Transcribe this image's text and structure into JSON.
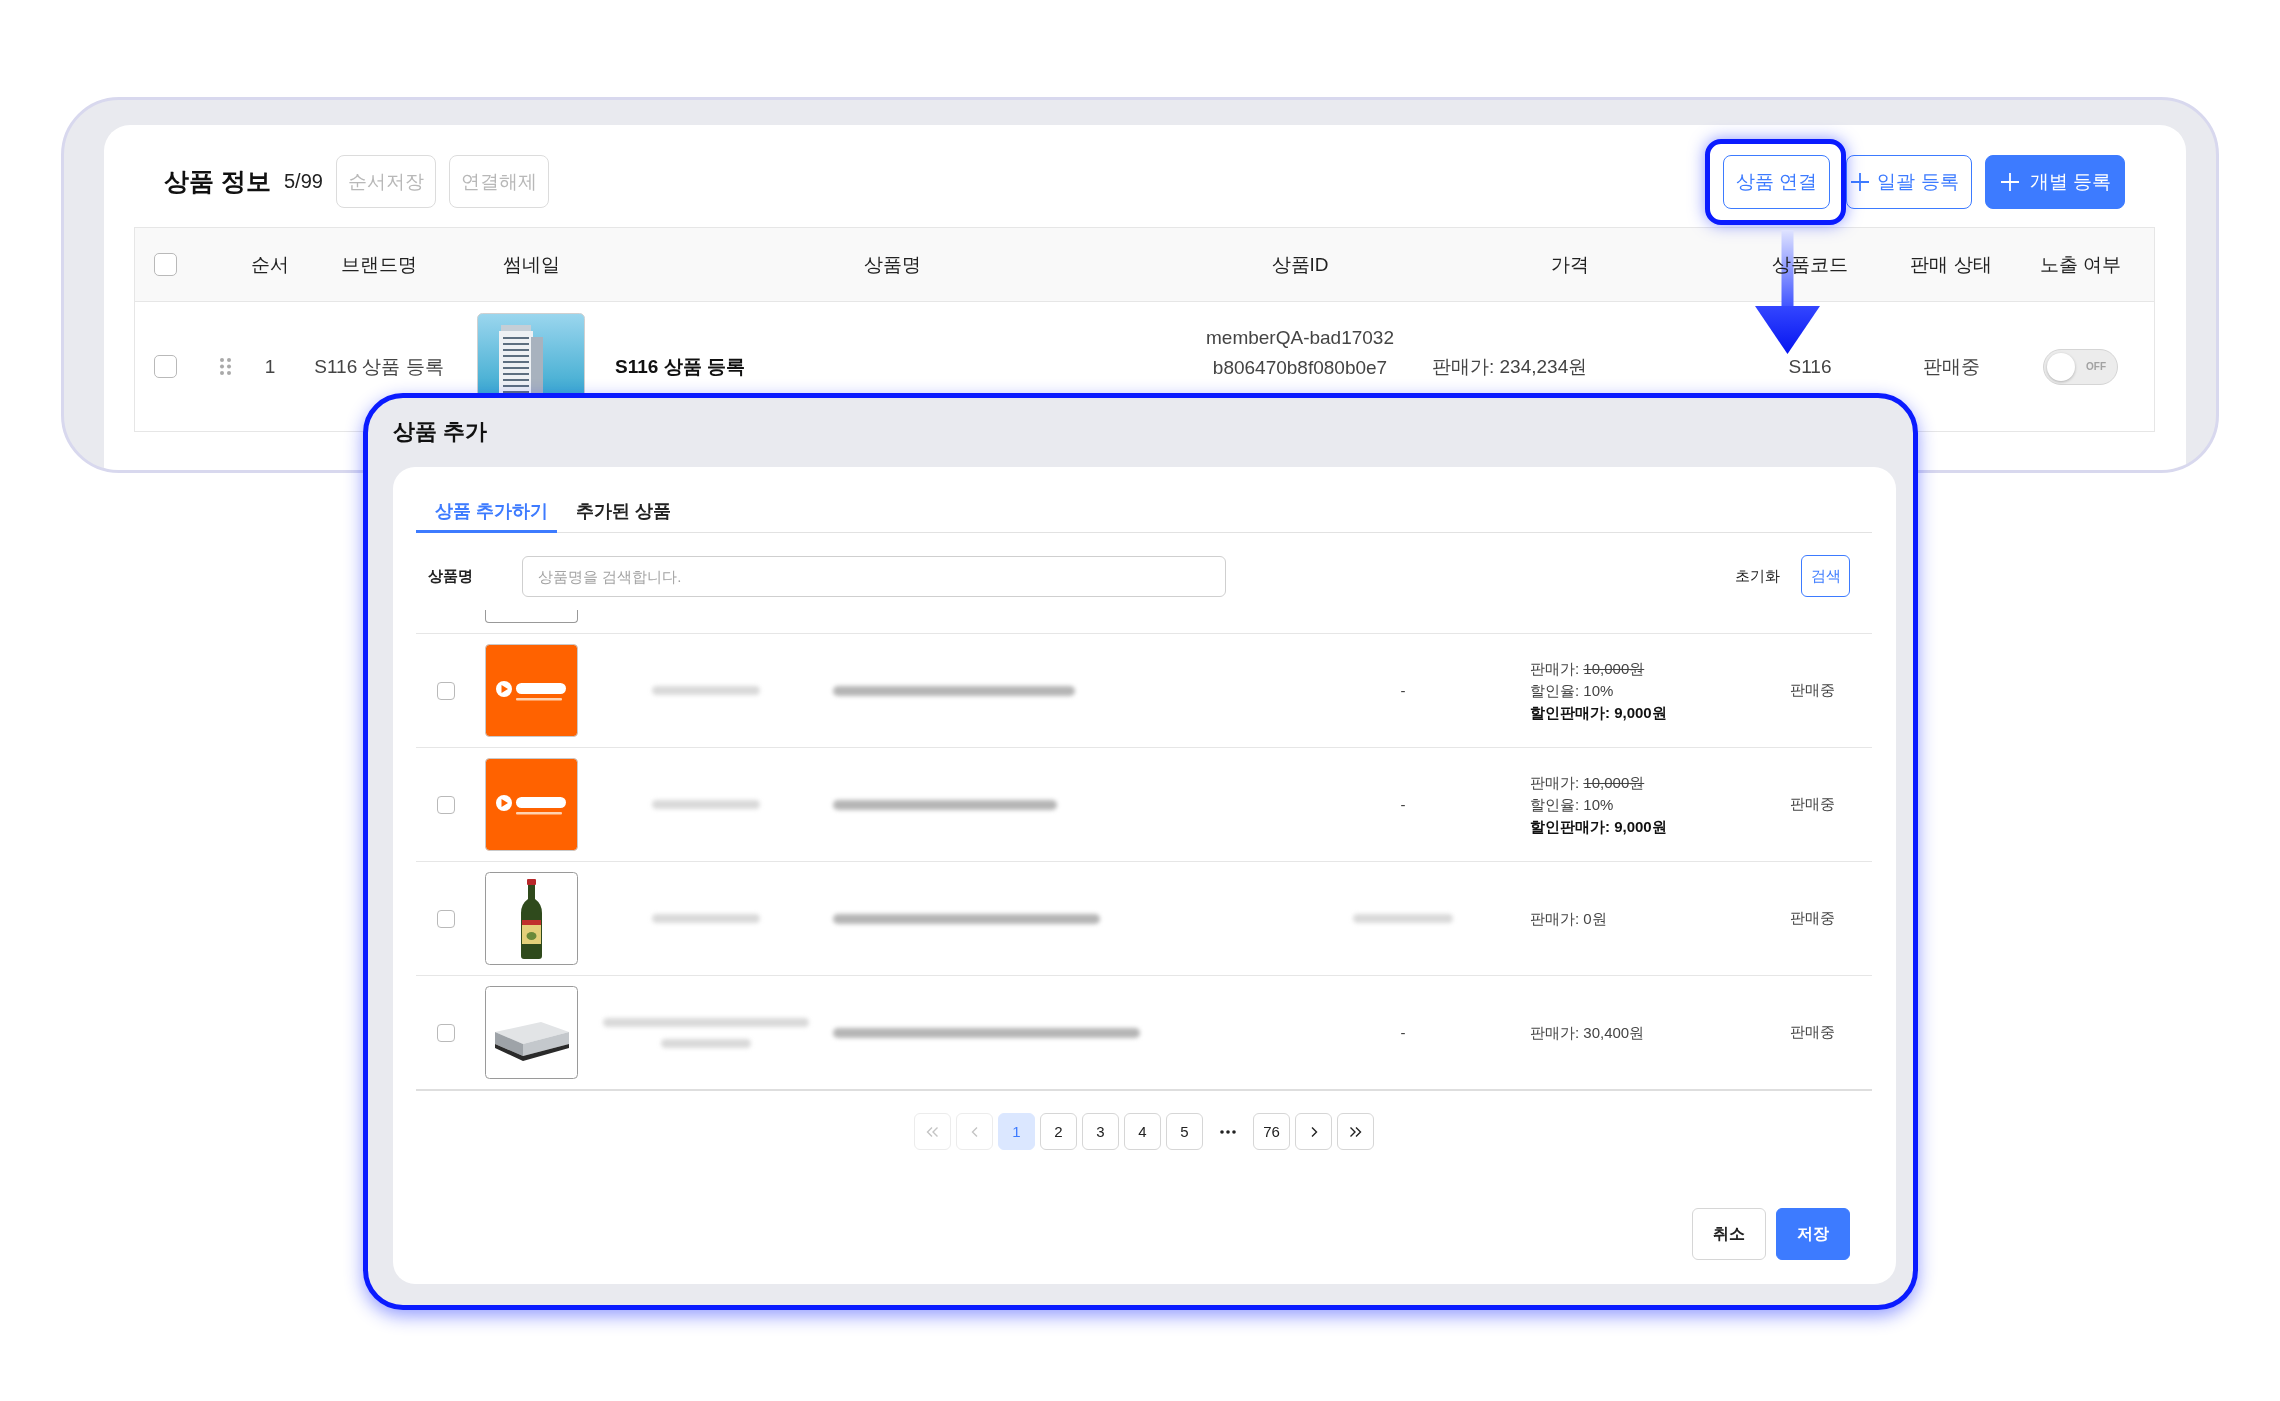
{
  "product_info": {
    "title": "상품 정보",
    "count": "5/99",
    "left_buttons": [
      {
        "label": "순서저장",
        "disabled": true
      },
      {
        "label": "연결해제",
        "disabled": true
      }
    ],
    "right_buttons": [
      {
        "kind": "outline",
        "label": "상품 연결",
        "highlighted": true
      },
      {
        "kind": "add-outline",
        "label": "일괄 등록",
        "highlighted": false
      },
      {
        "kind": "add-primary",
        "label": "개별 등록",
        "highlighted": false
      }
    ]
  },
  "product_table": {
    "all_checked": false,
    "columns": [
      "순서",
      "브랜드명",
      "썸네일",
      "상품명",
      "상품ID",
      "가격",
      "상품코드",
      "판매 상태",
      "노출 여부"
    ],
    "rows": [
      {
        "checked": false,
        "order": "1",
        "brand": "S116 상품 등록",
        "thumbnail": {
          "kind": "photo"
        },
        "name": "S116 상품 등록",
        "product_id_lines": [
          "memberQA-bad17032",
          "b806470b8f080b0e7"
        ],
        "price": "판매가: 234,234원",
        "code": "S116",
        "status": "판매중",
        "visible": {
          "on": false,
          "label": "OFF"
        }
      }
    ]
  },
  "modal": {
    "title": "상품 추가",
    "tabs": [
      {
        "label": "상품 추가하기",
        "selected": true
      },
      {
        "label": "추가된 상품",
        "selected": false
      }
    ],
    "search": {
      "label": "상품명",
      "placeholder": "상품명을 검색합니다.",
      "reset": "초기화",
      "button": "검색"
    },
    "rows": [
      {
        "checked": false,
        "thumbnail": {
          "kind": "logo"
        },
        "brand": {
          "kind": "blurred"
        },
        "name": {
          "kind": "blurred"
        },
        "code": {
          "kind": "text",
          "text": "-"
        },
        "price_lines": [
          {
            "kind": "struck",
            "label": "판매가:",
            "text": "10,000원"
          },
          {
            "kind": "plain",
            "text": "할인율: 10%"
          },
          {
            "kind": "bold",
            "text": "할인판매가: 9,000원"
          }
        ],
        "status": "판매중"
      },
      {
        "checked": false,
        "thumbnail": {
          "kind": "logo"
        },
        "brand": {
          "kind": "blurred"
        },
        "name": {
          "kind": "blurred"
        },
        "code": {
          "kind": "text",
          "text": "-"
        },
        "price_lines": [
          {
            "kind": "struck",
            "label": "판매가:",
            "text": "10,000원"
          },
          {
            "kind": "plain",
            "text": "할인율: 10%"
          },
          {
            "kind": "bold",
            "text": "할인판매가: 9,000원"
          }
        ],
        "status": "판매중"
      },
      {
        "checked": false,
        "thumbnail": {
          "kind": "bottle"
        },
        "brand": {
          "kind": "blurred"
        },
        "name": {
          "kind": "blurred"
        },
        "code": {
          "kind": "blurred"
        },
        "price_lines": [
          {
            "kind": "plain",
            "text": "판매가: 0원"
          }
        ],
        "status": "판매중"
      },
      {
        "checked": false,
        "thumbnail": {
          "kind": "box"
        },
        "brand": {
          "kind": "blurred-wrapped"
        },
        "name": {
          "kind": "blurred"
        },
        "code": {
          "kind": "text",
          "text": "-"
        },
        "price_lines": [
          {
            "kind": "plain",
            "text": "판매가: 30,400원"
          }
        ],
        "status": "판매중"
      }
    ],
    "pagination": {
      "nav_before": [
        {
          "kind": "first",
          "disabled": true
        },
        {
          "kind": "prev",
          "disabled": true
        }
      ],
      "pages_start": [
        {
          "label": "1",
          "selected": true
        },
        {
          "label": "2",
          "selected": false
        },
        {
          "label": "3",
          "selected": false
        },
        {
          "label": "4",
          "selected": false
        },
        {
          "label": "5",
          "selected": false
        }
      ],
      "ellipsis": true,
      "pages_end": [
        {
          "label": "76",
          "selected": false
        }
      ],
      "nav_after": [
        {
          "kind": "next",
          "disabled": false
        },
        {
          "kind": "last",
          "disabled": false
        }
      ]
    },
    "buttons": [
      {
        "kind": "outline",
        "label": "취소"
      },
      {
        "kind": "primary",
        "label": "저장"
      }
    ]
  }
}
